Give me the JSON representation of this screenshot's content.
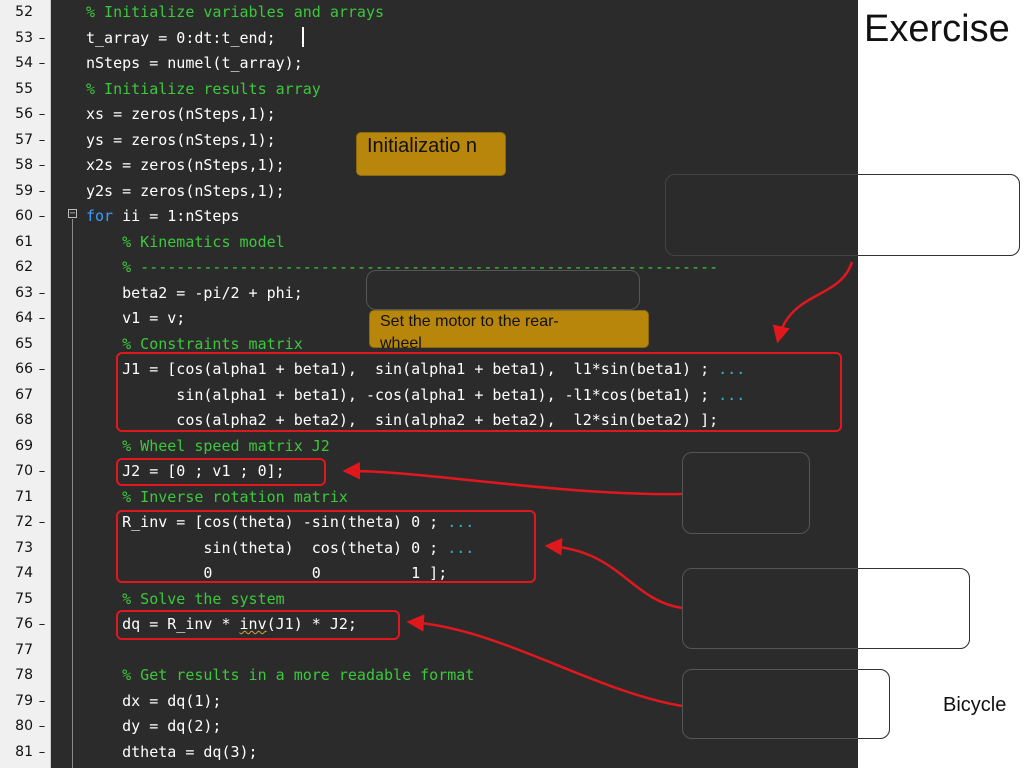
{
  "slide": {
    "title": "Exercise",
    "bottom_label": "Bicycle"
  },
  "notes": {
    "initialization": "Initializatio n",
    "motor": "Set the motor to the rear-wheel"
  },
  "colors": {
    "editor_background": "#2b2b2b",
    "comment": "#3cc83c",
    "keyword": "#3c9cff",
    "highlight_box": "#e0181e",
    "note_fill": "#b8860b"
  },
  "lines": [
    {
      "num": "52",
      "dash": "",
      "code": "% Initialize variables and arrays",
      "type": "comment"
    },
    {
      "num": "53",
      "dash": "–",
      "code": "t_array = 0:dt:t_end;",
      "type": "code"
    },
    {
      "num": "54",
      "dash": "–",
      "code": "nSteps = numel(t_array);",
      "type": "code"
    },
    {
      "num": "55",
      "dash": "",
      "code": "% Initialize results array",
      "type": "comment"
    },
    {
      "num": "56",
      "dash": "–",
      "code": "xs = zeros(nSteps,1);",
      "type": "code"
    },
    {
      "num": "57",
      "dash": "–",
      "code": "ys = zeros(nSteps,1);",
      "type": "code"
    },
    {
      "num": "58",
      "dash": "–",
      "code": "x2s = zeros(nSteps,1);",
      "type": "code"
    },
    {
      "num": "59",
      "dash": "–",
      "code": "y2s = zeros(nSteps,1);",
      "type": "code"
    },
    {
      "num": "60",
      "dash": "–",
      "code_kw": "for",
      "code": " ii = 1:nSteps",
      "type": "for"
    },
    {
      "num": "61",
      "dash": "",
      "code": "    % Kinematics model",
      "type": "comment"
    },
    {
      "num": "62",
      "dash": "",
      "code": "    % ----------------------------------------------------------------",
      "type": "comment"
    },
    {
      "num": "63",
      "dash": "–",
      "code": "    beta2 = -pi/2 + phi;",
      "type": "code"
    },
    {
      "num": "64",
      "dash": "–",
      "code": "    v1 = v;",
      "type": "code"
    },
    {
      "num": "65",
      "dash": "",
      "code": "    % Constraints matrix",
      "type": "comment"
    },
    {
      "num": "66",
      "dash": "–",
      "code": "    J1 = [cos(alpha1 + beta1),  sin(alpha1 + beta1),  l1*sin(beta1) ; ",
      "cont": "...",
      "type": "cont"
    },
    {
      "num": "67",
      "dash": "",
      "code": "          sin(alpha1 + beta1), -cos(alpha1 + beta1), -l1*cos(beta1) ; ",
      "cont": "...",
      "type": "cont"
    },
    {
      "num": "68",
      "dash": "",
      "code": "          cos(alpha2 + beta2),  sin(alpha2 + beta2),  l2*sin(beta2) ];",
      "type": "code"
    },
    {
      "num": "69",
      "dash": "",
      "code": "    % Wheel speed matrix J2",
      "type": "comment"
    },
    {
      "num": "70",
      "dash": "–",
      "code": "    J2 = [0 ; v1 ; 0];",
      "type": "code"
    },
    {
      "num": "71",
      "dash": "",
      "code": "    % Inverse rotation matrix",
      "type": "comment"
    },
    {
      "num": "72",
      "dash": "–",
      "code": "    R_inv = [cos(theta) -sin(theta) 0 ; ",
      "cont": "...",
      "type": "cont"
    },
    {
      "num": "73",
      "dash": "",
      "code": "             sin(theta)  cos(theta) 0 ; ",
      "cont": "...",
      "type": "cont"
    },
    {
      "num": "74",
      "dash": "",
      "code": "             0           0          1 ];",
      "type": "code"
    },
    {
      "num": "75",
      "dash": "",
      "code": "    % Solve the system",
      "type": "comment"
    },
    {
      "num": "76",
      "dash": "–",
      "code_pre": "    dq = R_inv * ",
      "code_squig": "inv",
      "code": "(J1) * J2;",
      "type": "squig"
    },
    {
      "num": "77",
      "dash": "",
      "code": "",
      "type": "code"
    },
    {
      "num": "78",
      "dash": "",
      "code": "    % Get results in a more readable format",
      "type": "comment"
    },
    {
      "num": "79",
      "dash": "–",
      "code": "    dx = dq(1);",
      "type": "code"
    },
    {
      "num": "80",
      "dash": "–",
      "code": "    dy = dq(2);",
      "type": "code"
    },
    {
      "num": "81",
      "dash": "–",
      "code": "    dtheta = dq(3);",
      "type": "code"
    }
  ]
}
